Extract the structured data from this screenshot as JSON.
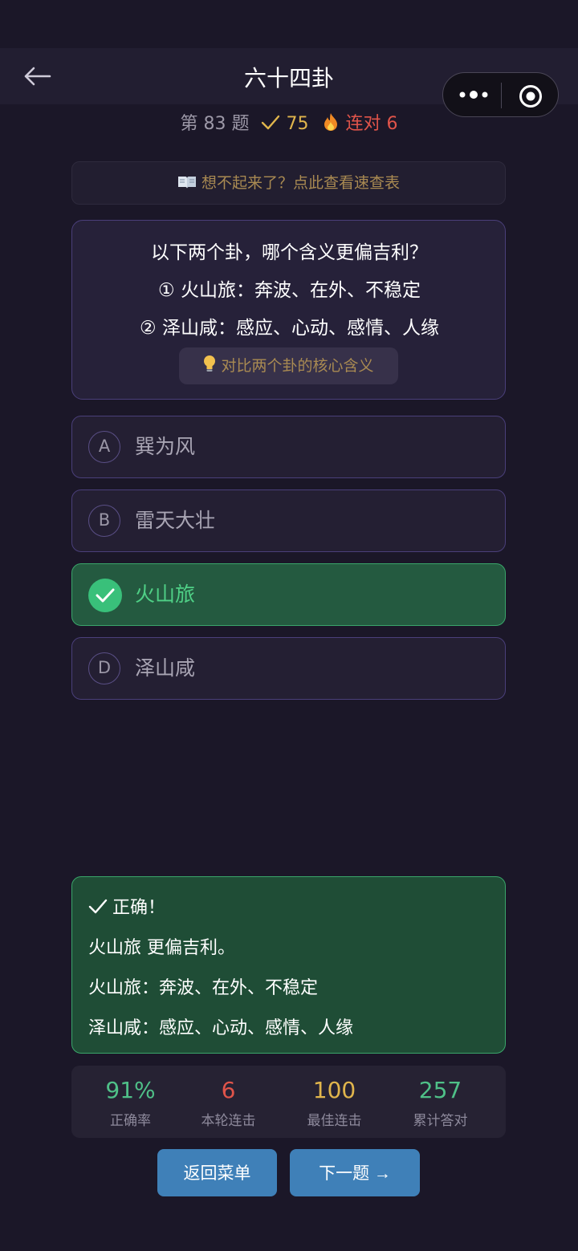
{
  "nav": {
    "title": "六十四卦",
    "back_icon": "arrow-left-icon",
    "more_icon": "more-dots-icon",
    "target_icon": "target-icon"
  },
  "status": {
    "question_number": "第 83 题",
    "score": "75",
    "streak": "连对 6"
  },
  "cheatsheet": {
    "label": "想不起来了？点此查看速查表",
    "icon": "book-icon"
  },
  "question": {
    "prompt": "以下两个卦，哪个含义更偏吉利？",
    "item1": "① 火山旅：奔波、在外、不稳定",
    "item2": "② 泽山咸：感应、心动、感情、人缘",
    "hint": "对比两个卦的核心含义",
    "hint_icon": "lightbulb-icon"
  },
  "options": [
    {
      "letter": "A",
      "text": "巽为风",
      "state": "normal"
    },
    {
      "letter": "B",
      "text": "雷天大壮",
      "state": "normal"
    },
    {
      "letter": "C",
      "text": "火山旅",
      "state": "correct"
    },
    {
      "letter": "D",
      "text": "泽山咸",
      "state": "normal"
    }
  ],
  "result": {
    "header": "正确！",
    "line1": "火山旅 更偏吉利。",
    "line2": "火山旅：奔波、在外、不稳定",
    "line3": "泽山咸：感应、心动、感情、人缘"
  },
  "stats": [
    {
      "value": "91%",
      "label": "正确率",
      "color": "#4fc088"
    },
    {
      "value": "6",
      "label": "本轮连击",
      "color": "#e0544a"
    },
    {
      "value": "100",
      "label": "最佳连击",
      "color": "#e0b54c"
    },
    {
      "value": "257",
      "label": "累计答对",
      "color": "#4fc088"
    }
  ],
  "buttons": {
    "back_menu": "返回菜单",
    "next": "下一题 →"
  },
  "colors": {
    "background": "#1b1728",
    "correct": "#39c07a",
    "accent_gold": "#e0b54c",
    "accent_red": "#e0544a",
    "button": "#3f80b8"
  }
}
